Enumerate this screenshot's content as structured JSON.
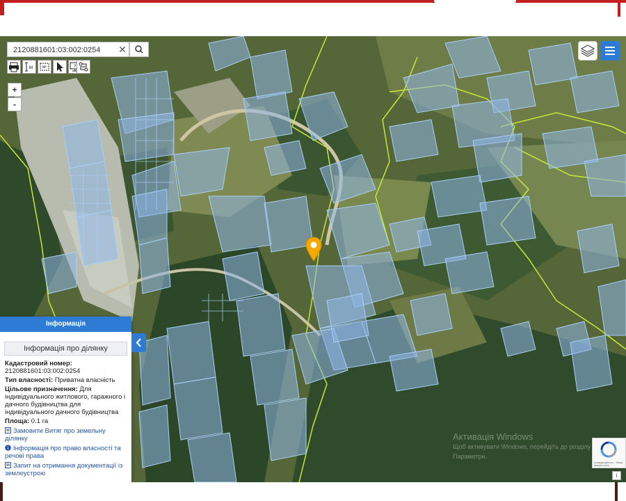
{
  "search": {
    "value": "2120881601:03:002:0254"
  },
  "toolbar": {
    "print_icon": "printer-icon",
    "measure_line_icon": "measure-length-icon",
    "measure_area_icon": "measure-area-icon",
    "select_icon": "cursor-icon",
    "info_icon": "screen-info-icon",
    "profile_icon": "route-icon"
  },
  "zoom": {
    "in_label": "+",
    "out_label": "-"
  },
  "panel": {
    "header": "Інформація",
    "subheader": "Інформація про ділянку",
    "cadastral_label": "Кадастровий номер:",
    "cadastral_value": "2120881601:03:002:0254",
    "ownership_label": "Тип власності:",
    "ownership_value": "Приватна власність",
    "purpose_label": "Цільове призначення:",
    "purpose_value": "Для індивідуального житлового, гаражного і дачного будівництва для індивідуального дачного будівництва",
    "area_label": "Площа:",
    "area_value": "0.1 га",
    "link1": "Замовити Витяг про земельну ділянку",
    "link2": "Інформація про право власності та речові права",
    "link3": "Запит на отримання документації із землеустрою"
  },
  "watermark": {
    "line1": "Активація Windows",
    "line2": "Щоб активувати Windows, перейдіть до розділу Параметри."
  },
  "recaptcha": {
    "text": "Конфіденційність - Умови використання"
  },
  "colors": {
    "accent": "#2e7bd6",
    "brand_red": "#c41f1f",
    "parcel_fill": "#8fb6e8",
    "parcel_stroke": "#a8cff5",
    "boundary": "#c9e63a",
    "pin": "#f5a800"
  }
}
